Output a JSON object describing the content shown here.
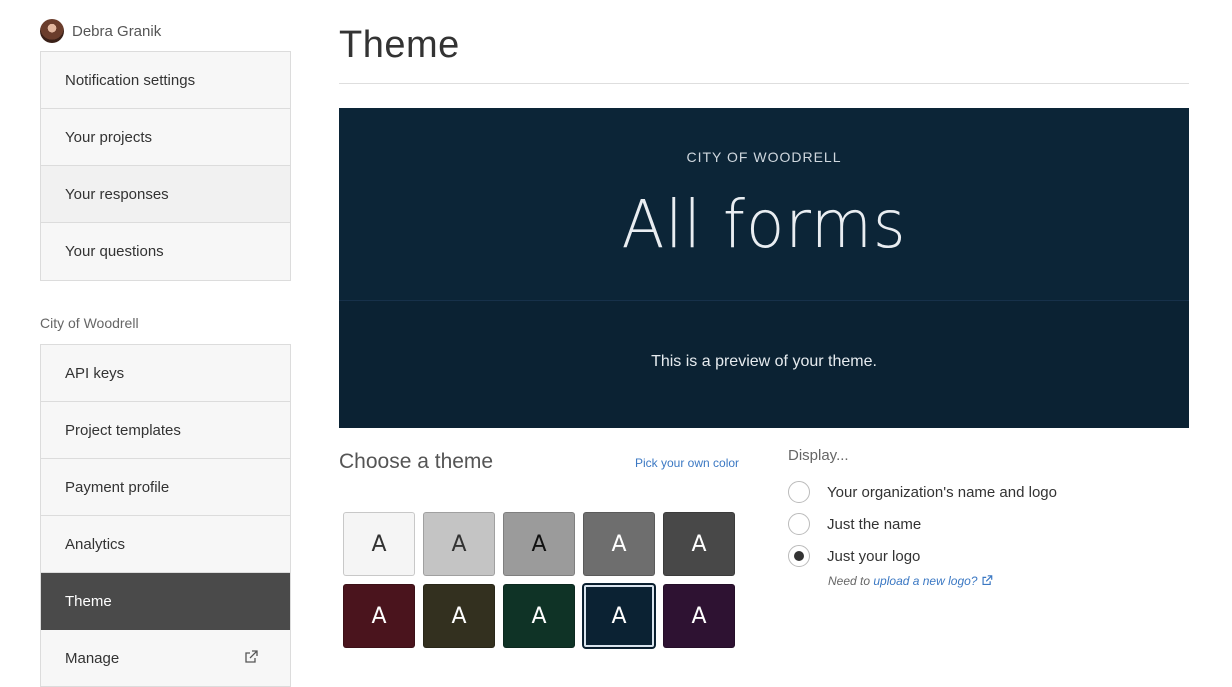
{
  "user": {
    "name": "Debra Granik"
  },
  "sidebar": {
    "personal_items": [
      {
        "label": "Notification settings"
      },
      {
        "label": "Your projects"
      },
      {
        "label": "Your responses"
      },
      {
        "label": "Your questions"
      }
    ],
    "org_label": "City of Woodrell",
    "org_items": [
      {
        "label": "API keys"
      },
      {
        "label": "Project templates"
      },
      {
        "label": "Payment profile"
      },
      {
        "label": "Analytics"
      },
      {
        "label": "Theme",
        "active": true
      },
      {
        "label": "Manage",
        "external_icon": "external-link-icon"
      }
    ]
  },
  "main": {
    "title": "Theme",
    "preview": {
      "org_name": "CITY OF WOODRELL",
      "title": "All forms",
      "note": "This is a preview of your theme.",
      "background": "#0b2233"
    },
    "choose": {
      "title": "Choose a theme",
      "pick_link": "Pick your own color",
      "swatch_letter": "A",
      "swatches": [
        {
          "bg": "#f5f5f5",
          "fg": "#333333"
        },
        {
          "bg": "#c4c4c4",
          "fg": "#333333"
        },
        {
          "bg": "#9b9b9b",
          "fg": "#111111"
        },
        {
          "bg": "#6e6e6e",
          "fg": "#ffffff"
        },
        {
          "bg": "#484848",
          "fg": "#ffffff"
        },
        {
          "bg": "#4a141d",
          "fg": "#ffffff"
        },
        {
          "bg": "#33301f",
          "fg": "#ffffff"
        },
        {
          "bg": "#0f3326",
          "fg": "#ffffff"
        },
        {
          "bg": "#0b2233",
          "fg": "#ffffff",
          "selected": true
        },
        {
          "bg": "#2e1232",
          "fg": "#ffffff"
        }
      ]
    },
    "display": {
      "label": "Display...",
      "options": [
        {
          "label": "Your organization's name and logo",
          "checked": false
        },
        {
          "label": "Just the name",
          "checked": false
        },
        {
          "label": "Just your logo",
          "checked": true
        }
      ],
      "hint_prefix": "Need to ",
      "hint_link": "upload a new logo?"
    }
  }
}
